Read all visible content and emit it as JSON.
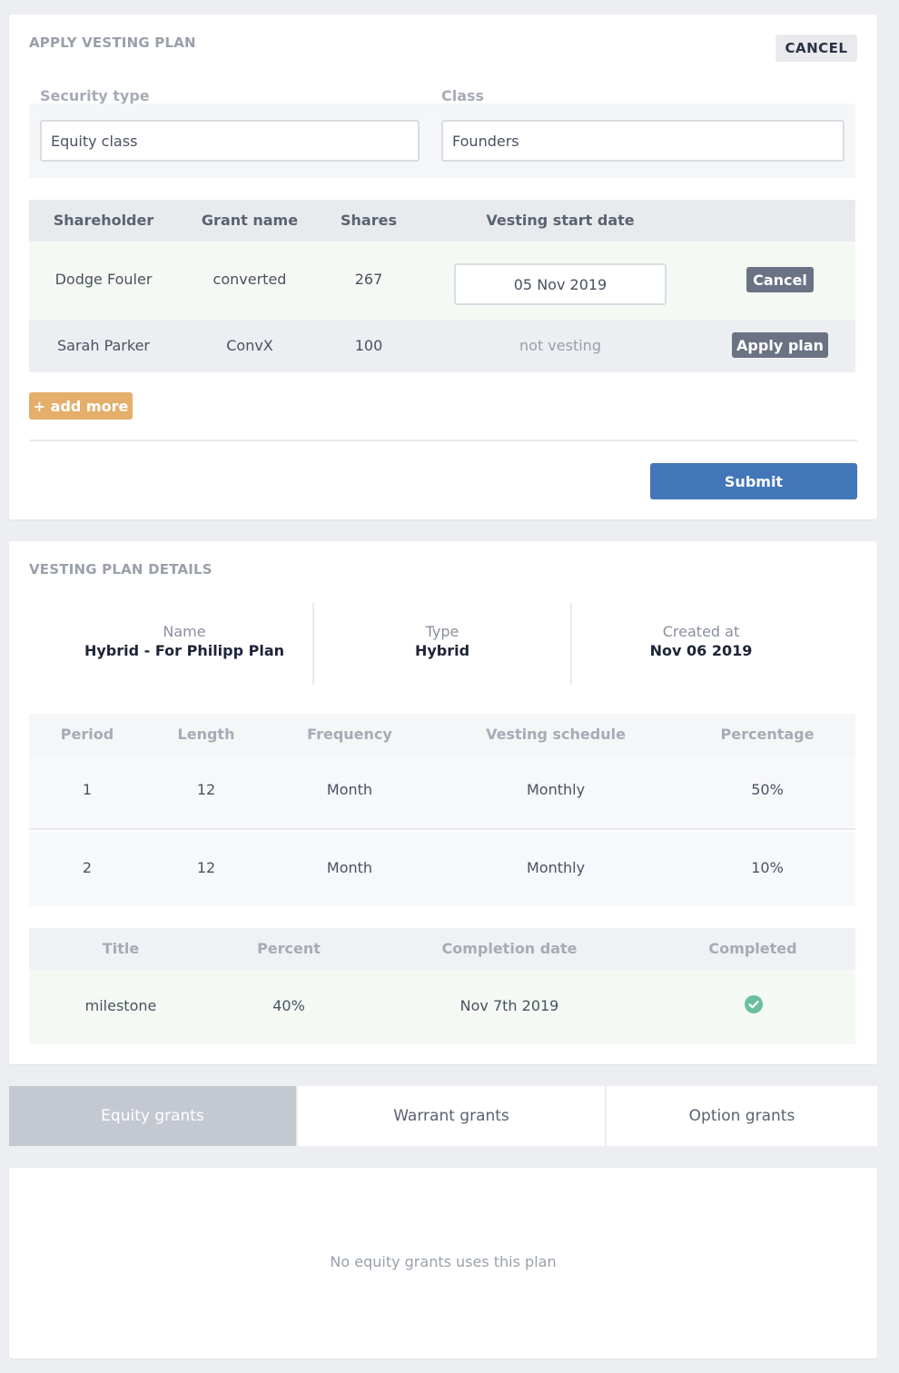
{
  "apply_plan": {
    "title": "APPLY VESTING PLAN",
    "cancel_label": "CANCEL",
    "security_type_label": "Security type",
    "class_label": "Class",
    "security_type_value": "Equity class",
    "class_value": "Founders",
    "columns": [
      "Shareholder",
      "Grant name",
      "Shares",
      "Vesting start date"
    ],
    "rows": [
      {
        "shareholder": "Dodge Fouler",
        "grant_name": "converted",
        "shares": "267",
        "vesting_start": "05 Nov 2019",
        "action": "Cancel"
      },
      {
        "shareholder": "Sarah Parker",
        "grant_name": "ConvX",
        "shares": "100",
        "vesting_start": "not vesting",
        "action": "Apply plan"
      }
    ],
    "add_more_label": "+ add more",
    "submit_label": "Submit"
  },
  "plan_details": {
    "title": "VESTING PLAN DETAILS",
    "name_label": "Name",
    "name_value": "Hybrid - For Philipp Plan",
    "type_label": "Type",
    "type_value": "Hybrid",
    "created_label": "Created at",
    "created_value": "Nov 06 2019",
    "period_columns": [
      "Period",
      "Length",
      "Frequency",
      "Vesting schedule",
      "Percentage"
    ],
    "periods": [
      {
        "period": "1",
        "length": "12",
        "frequency": "Month",
        "schedule": "Monthly",
        "percentage": "50%"
      },
      {
        "period": "2",
        "length": "12",
        "frequency": "Month",
        "schedule": "Monthly",
        "percentage": "10%"
      }
    ],
    "milestone_columns": [
      "Title",
      "Percent",
      "Completion date",
      "Completed"
    ],
    "milestones": [
      {
        "title": "milestone",
        "percent": "40%",
        "completion_date": "Nov 7th 2019",
        "completed_icon": "check-circle-icon"
      }
    ]
  },
  "tabs": {
    "items": [
      "Equity grants",
      "Warrant grants",
      "Option grants"
    ],
    "active_index": 0
  },
  "grants_panel": {
    "empty_message": "No equity grants uses this plan"
  },
  "colors": {
    "accent_blue": "#4376b8",
    "add_more_orange": "#e5ae6a",
    "slate_button": "#6a7284",
    "active_row": "#f4faf3",
    "check_green": "#6bbf9f"
  }
}
